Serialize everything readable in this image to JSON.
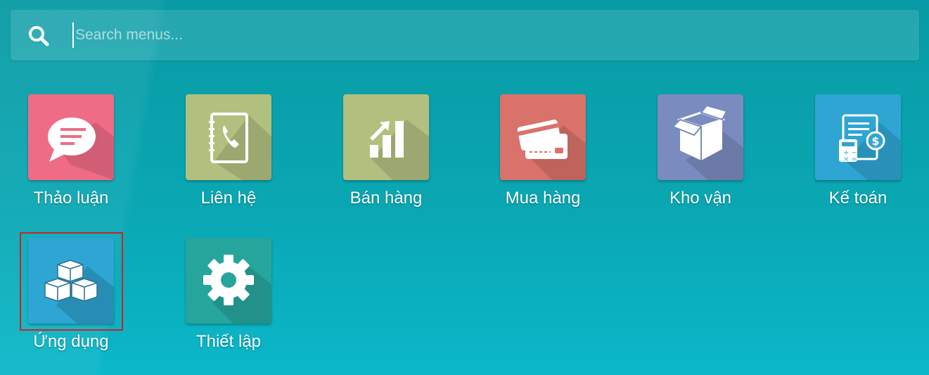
{
  "search": {
    "placeholder": "Search menus..."
  },
  "apps": [
    {
      "label": "Thảo luận",
      "icon": "chat-bubble-icon",
      "color": "#ee6c86"
    },
    {
      "label": "Liên hệ",
      "icon": "contact-book-icon",
      "color": "#b2c07f"
    },
    {
      "label": "Bán hàng",
      "icon": "sales-chart-icon",
      "color": "#b2c07f"
    },
    {
      "label": "Mua hàng",
      "icon": "credit-card-icon",
      "color": "#d9726a"
    },
    {
      "label": "Kho vận",
      "icon": "box-icon",
      "color": "#7a8bbf"
    },
    {
      "label": "Kế toán",
      "icon": "invoice-icon",
      "color": "#2fa5d3"
    },
    {
      "label": "Ứng dụng",
      "icon": "cubes-icon",
      "color": "#2fa5d3"
    },
    {
      "label": "Thiết lập",
      "icon": "gear-icon",
      "color": "#26a59c"
    }
  ]
}
